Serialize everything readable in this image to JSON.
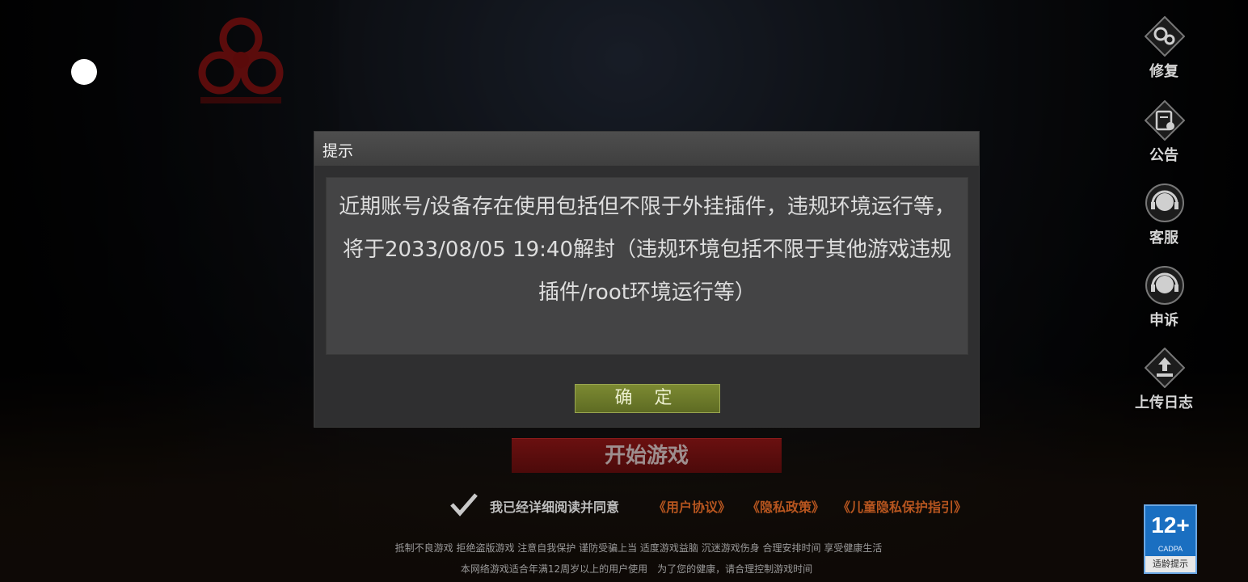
{
  "sidebar": {
    "items": [
      {
        "label": "修复",
        "icon": "gear-icon"
      },
      {
        "label": "公告",
        "icon": "announcement-icon"
      },
      {
        "label": "客服",
        "icon": "headset-icon"
      },
      {
        "label": "申诉",
        "icon": "headset-icon"
      },
      {
        "label": "上传日志",
        "icon": "upload-icon"
      }
    ]
  },
  "dialog": {
    "title": "提示",
    "message": "近期账号/设备存在使用包括但不限于外挂插件，违规环境运行等，将于2033/08/05 19:40解封（违规环境包括不限于其他游戏违规插件/root环境运行等）",
    "confirm_label": "确 定"
  },
  "start_button": "开始游戏",
  "agreement": {
    "text": "我已经详细阅读并同意",
    "user_agreement": "《用户协议》",
    "privacy_policy": "《隐私政策》",
    "child_privacy": "《儿童隐私保护指引》"
  },
  "notice": {
    "line1": "抵制不良游戏 拒绝盗版游戏 注意自我保护 谨防受骗上当 适度游戏益脑 沉迷游戏伤身 合理安排时间 享受健康生活",
    "line2": "本网络游戏适合年满12周岁以上的用户使用　为了您的健康，请合理控制游戏时间"
  },
  "age_rating": {
    "value": "12+",
    "org": "CADPA",
    "tip": "适龄提示"
  },
  "colors": {
    "dialog_bg": "#2f2f30",
    "confirm_button": "#6c7a2a",
    "start_button": "#5a0d0d",
    "link_orange": "#b6551f",
    "age_blue": "#1a6fc1"
  }
}
